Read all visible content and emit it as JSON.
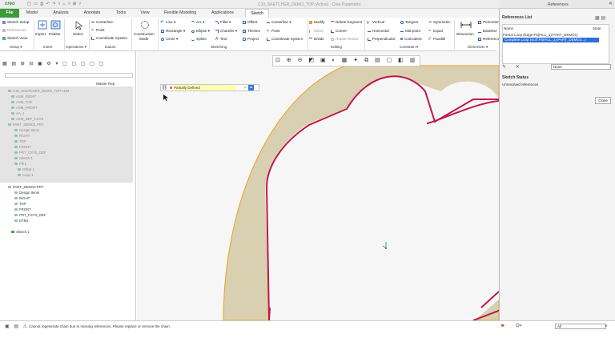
{
  "titlebar": {
    "logo": "creo",
    "quick_access": "▢ ▭ ⎙ ↶ ↷ ▿ ⌂ ▿ ⊞ ▿",
    "window_title": "C10_SKETCHER_DEMO_TOP (Active) · Creo Parametric",
    "window_controls": "– ▢ ✕"
  },
  "tabs": [
    "File",
    "Model",
    "Analysis",
    "Annotate",
    "Tools",
    "View",
    "Flexible Modeling",
    "Applications",
    "Sketch"
  ],
  "ribbon": {
    "setup": {
      "sketch_setup": "Sketch Setup",
      "references": "References",
      "sketch_view": "Sketch View",
      "group": "Setup ▾"
    },
    "insert": {
      "import": "Import",
      "palette": "Palette",
      "group": "Insert"
    },
    "operations": {
      "select": "Select",
      "group": "Operations ▾"
    },
    "datum": {
      "centerline": "Centerline",
      "point": "Point",
      "coordinate_system": "Coordinate System",
      "group": "Datum"
    },
    "construction": {
      "label": "Construction",
      "label2": "Mode"
    },
    "sketching": {
      "line": "Line ▾",
      "rectangle": "Rectangle ▾",
      "circle": "Circle ▾",
      "arc": "Arc ▾",
      "ellipse": "Ellipse ▾",
      "spline": "Spline",
      "fillet": "Fillet ▾",
      "chamfer": "Chamfer ▾",
      "text": "Text",
      "offset": "Offset",
      "thicken": "Thicken",
      "project": "Project",
      "centerline": "Centerline ▾",
      "point": "Point",
      "coordinate_system": "Coordinate System",
      "group": "Sketching"
    },
    "editing": {
      "modify": "Modify",
      "mirror": "Mirror",
      "divide": "Divide",
      "delete_segment": "Delete Segment",
      "corner": "Corner",
      "rotate_resize": "Rotate Resize",
      "group": "Editing"
    },
    "constrain": {
      "vertical": "Vertical",
      "horizontal": "Horizontal",
      "perpendicular": "Perpendicular",
      "tangent": "Tangent",
      "mid_point": "Mid-point",
      "coincident": "Coincident",
      "symmetric": "Symmetric",
      "equal": "Equal",
      "parallel": "Parallel",
      "group": "Constrain ▾"
    },
    "dimension": {
      "dimension": "Dimension",
      "perimeter": "Perimeter",
      "baseline": "Baseline",
      "reference": "Reference",
      "group": "Dimension ▾"
    }
  },
  "left_panel": {
    "master_rep": "Master Rep",
    "tree_top": [
      "C10_SKETCHER_DEMO_TOP.ASM",
      "ASM_RIGHT",
      "ASM_TOP",
      "ASM_FRONT",
      "AA_1",
      "ASM_DEF_CSYS",
      "PART_DEMO1.PRT",
      "Design Items",
      "RIGHT",
      "TOP",
      "FRONT",
      "PRT_CSYS_DEF",
      "Sketch 1",
      "Fill 1",
      "Offset 1",
      "Copy 1"
    ],
    "tree_bottom": [
      "PART_DEMO2.PRT",
      "Design Items",
      "RIGHT",
      "TOP",
      "FRONT",
      "PRT_CSYS_DEF",
      "DTM1"
    ],
    "active_sketch": "Sketch 1"
  },
  "canvas": {
    "status_text": "Partially Defined"
  },
  "references_panel": {
    "title": "References",
    "list_title": "References List",
    "col_name": "Name",
    "col_state": "State",
    "rows": [
      "Partial Loop (Edge:F5(FILL_1):PART_DEMO1)",
      "Complete Loop (Surf:F5(FILL_1):PART_DEMO1...)"
    ],
    "selection": "None",
    "sketch_status_title": "Sketch Status",
    "sketch_status_text": "Unresolved references",
    "close_label": "Close"
  },
  "status_bar": {
    "message": "Cannot regenerate chain due to missing references. Please replace or remove the chain.",
    "filter_value": "All"
  },
  "colors": {
    "accent": "#3a9b3a",
    "selection": "#2f6fd6",
    "profile": "#c0184a",
    "surface": "#d8d0b0",
    "edge": "#f0a020"
  }
}
